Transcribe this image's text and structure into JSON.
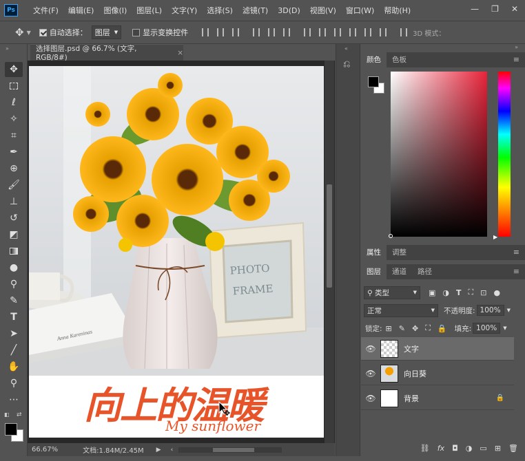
{
  "app": {
    "logo": "Ps"
  },
  "menu": [
    "文件(F)",
    "编辑(E)",
    "图像(I)",
    "图层(L)",
    "文字(Y)",
    "选择(S)",
    "滤镜(T)",
    "3D(D)",
    "视图(V)",
    "窗口(W)",
    "帮助(H)"
  ],
  "window_buttons": {
    "minimize": "—",
    "restore": "❐",
    "close": "✕"
  },
  "options": {
    "auto_select_label": "自动选择：",
    "auto_select_checked": true,
    "auto_select_target": "图层",
    "show_transform_label": "显示变换控件",
    "show_transform_checked": false,
    "mode_3d_label": "3D 模式："
  },
  "document": {
    "tab_title": "选择图层.psd @ 66.7% (文字, RGB/8#)",
    "close": "×",
    "zoom": "66.67%",
    "doc_info": "文档:1.84M/2.45M",
    "photo_frame_text": [
      "PHOTO",
      "FRAME"
    ],
    "book_text": "Anna Kareninas",
    "calligraphy": "向上的温暖",
    "script_text": "My sunflower"
  },
  "color_panel": {
    "tabs": [
      "颜色",
      "色板"
    ],
    "active_tab": "颜色",
    "foreground": "#000000",
    "background": "#ffffff"
  },
  "properties_panel": {
    "tabs": [
      "属性",
      "调整"
    ],
    "active_tab": "属性"
  },
  "layers_panel": {
    "tabs": [
      "图层",
      "通道",
      "路径"
    ],
    "active_tab": "图层",
    "filter_kind": "类型",
    "blend_mode": "正常",
    "opacity_label": "不透明度:",
    "opacity": "100%",
    "lock_label": "锁定:",
    "fill_label": "填充:",
    "fill": "100%",
    "layers": [
      {
        "name": "文字",
        "visible": true,
        "selected": true,
        "thumb": "transparent"
      },
      {
        "name": "向日葵",
        "visible": true,
        "selected": false,
        "thumb": "sunflower"
      },
      {
        "name": "背景",
        "visible": true,
        "selected": false,
        "thumb": "white",
        "locked": true
      }
    ],
    "footer_icons": [
      "link-icon",
      "fx-icon",
      "mask-icon",
      "adjustment-icon",
      "group-icon",
      "new-layer-icon",
      "delete-icon"
    ]
  },
  "colors": {
    "accent": "#31a8ff",
    "calligraphy": "#e8542a",
    "ui_bg": "#535353"
  }
}
